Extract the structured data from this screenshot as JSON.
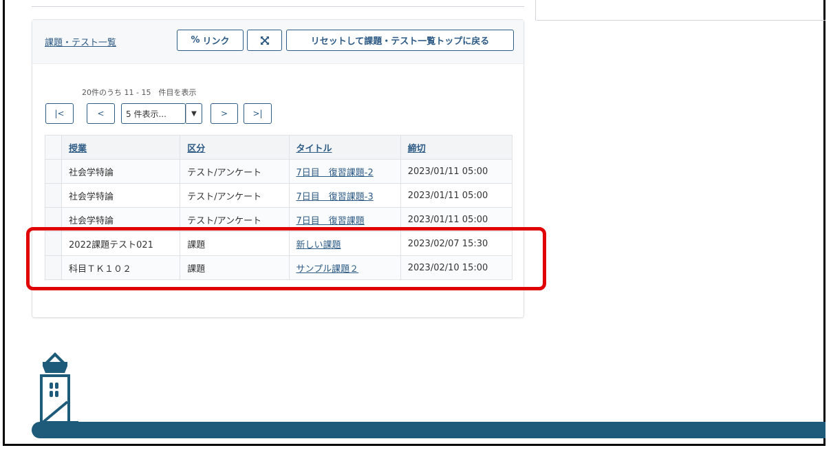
{
  "panel": {
    "title": "課題・テスト一覧",
    "link_button": "リンク",
    "reset_button": "リセットして課題・テスト一覧トップに戻る"
  },
  "pagination": {
    "summary": "20件のうち 11 - 15　件目を表示",
    "first": "|<",
    "prev": "<",
    "per_page_selected": "5 件表示...",
    "next": ">",
    "last": ">|"
  },
  "table": {
    "headers": [
      "授業",
      "区分",
      "タイトル",
      "締切"
    ],
    "rows": [
      {
        "course": "社会学特論",
        "type": "テスト/アンケート",
        "title": "7日目　復習課題-2",
        "due": "2023/01/11 05:00"
      },
      {
        "course": "社会学特論",
        "type": "テスト/アンケート",
        "title": "7日目　復習課題-3",
        "due": "2023/01/11 05:00"
      },
      {
        "course": "社会学特論",
        "type": "テスト/アンケート",
        "title": "7日目　復習課題",
        "due": "2023/01/11 05:00"
      },
      {
        "course": "2022課題テスト021",
        "type": "課題",
        "title": "新しい課題",
        "due": "2023/02/07 15:30"
      },
      {
        "course": "科目ＴＫ１０２",
        "type": "課題",
        "title": "サンプル課題２",
        "due": "2023/02/10 15:00"
      }
    ]
  },
  "colors": {
    "accent": "#2c5a85",
    "highlight": "#e00000",
    "footer": "#1e5a7a"
  }
}
